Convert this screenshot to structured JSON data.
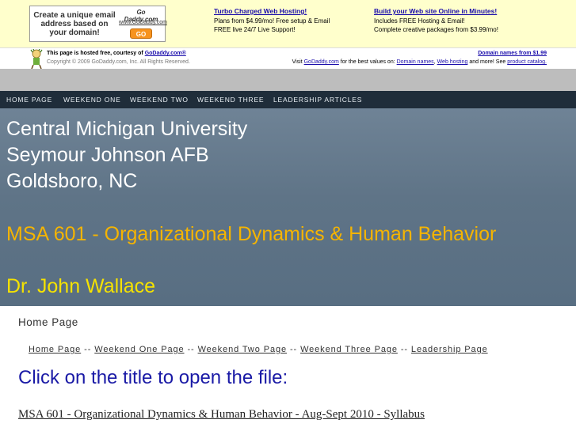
{
  "ad": {
    "box_text": "Create a unique email address based on your domain!",
    "logo_brand": "Go Daddy.com",
    "logo_url": "www.GoDaddy.com",
    "go_label": "GO",
    "col1": {
      "headline": "Turbo Charged Web Hosting!",
      "line1": "Plans from $4.99/mo! Free setup & Email",
      "line2": "FREE live 24/7 Live Support!"
    },
    "col2": {
      "headline": "Build your Web site Online in Minutes!",
      "line1": "Includes FREE Hosting & Email!",
      "line2": "Complete creative packages from $3.99/mo!"
    }
  },
  "hosted": {
    "line1_prefix": "This page is hosted free, courtesy of ",
    "line1_link": "GoDaddy.com®",
    "line2": "Copyright © 2009 GoDaddy.com, Inc. All Rights Reserved.",
    "right_top": "Domain names from $1.99",
    "right_bottom_prefix": "Visit ",
    "right_bottom_link1": "GoDaddy.com",
    "right_bottom_mid": " for the best values on: ",
    "right_bottom_link2": "Domain names",
    "right_bottom_sep": ", ",
    "right_bottom_link3": "Web hosting",
    "right_bottom_mid2": " and more! See ",
    "right_bottom_link4": "product catalog."
  },
  "nav": {
    "items": [
      "HOME PAGE",
      "WEEKEND ONE",
      "WEEKEND TWO",
      "WEEKEND THREE",
      "LEADERSHIP ARTICLES"
    ]
  },
  "header": {
    "line1": "Central Michigan University",
    "line2": "Seymour Johnson AFB",
    "line3": "Goldsboro, NC",
    "course": "MSA 601 - Organizational Dynamics & Human Behavior",
    "instructor": "Dr. John Wallace"
  },
  "panel": {
    "title": "Home Page",
    "links": [
      "Home Page",
      "Weekend One Page",
      "Weekend Two Page",
      "Weekend Three Page",
      "Leadership Page"
    ],
    "separator": " -- ",
    "instruction": "Click on the title to open the file:",
    "file_link": "MSA 601 - Organizational Dynamics & Human Behavior - Aug-Sept 2010 - Syllabus"
  },
  "colors": {
    "nav_bg": "#1f2d3a",
    "header_bg": "#5f7487",
    "instructor_color": "#f5e200",
    "course_color": "#f5b400",
    "instruction_color": "#1a1aa6"
  }
}
